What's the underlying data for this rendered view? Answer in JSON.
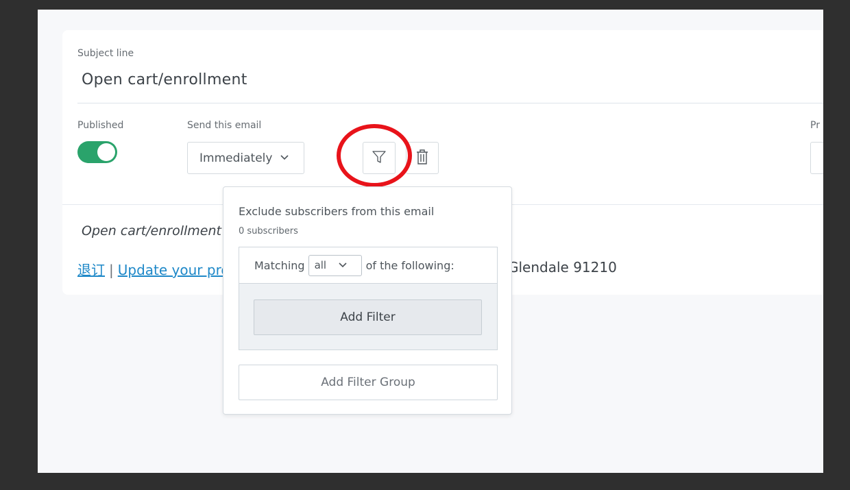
{
  "email": {
    "subject_label": "Subject line",
    "subject_value": "Open cart/enrollment",
    "published_label": "Published",
    "published_on": true,
    "send_label": "Send this email",
    "send_value": "Immediately",
    "pr_label": "Pr"
  },
  "footer": {
    "italic_text": "Open cart/enrollment",
    "unsubscribe_link": "退订",
    "separator": "|",
    "update_link": "Update your pro",
    "address_tail": "Glendale 91210"
  },
  "popover": {
    "title": "Exclude subscribers from this email",
    "count": "0 subscribers",
    "matching_prefix": "Matching",
    "matching_value": "all",
    "matching_suffix": "of the following:",
    "add_filter": "Add Filter",
    "add_filter_group": "Add Filter Group"
  },
  "icons": {
    "filter": "filter-icon",
    "trash": "trash-icon",
    "chevron": "chevron-down-icon"
  },
  "colors": {
    "toggle_on": "#2aa36b",
    "link": "#1e88c8",
    "highlight": "#e8131a"
  }
}
